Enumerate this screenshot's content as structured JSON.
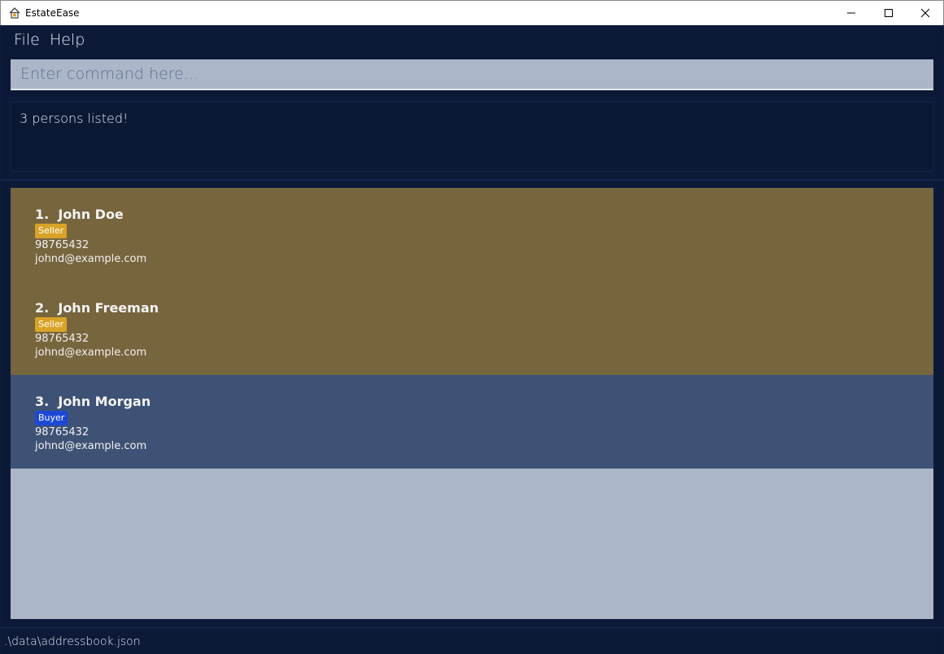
{
  "window": {
    "title": "EstateEase",
    "icon": "house-icon",
    "controls": {
      "minimize": "minimize-icon",
      "maximize": "maximize-icon",
      "close": "close-icon"
    }
  },
  "menu": {
    "file": "File",
    "help": "Help"
  },
  "command": {
    "placeholder": "Enter command here...",
    "value": ""
  },
  "result": {
    "message": "3 persons listed!"
  },
  "persons": [
    {
      "index": "1.",
      "name": "John Doe",
      "role": "Seller",
      "phone": "98765432",
      "email": "johnd@example.com"
    },
    {
      "index": "2.",
      "name": "John Freeman",
      "role": "Seller",
      "phone": "98765432",
      "email": "johnd@example.com"
    },
    {
      "index": "3.",
      "name": "John Morgan",
      "role": "Buyer",
      "phone": "98765432",
      "email": "johnd@example.com"
    }
  ],
  "colors": {
    "seller_card": "#77653e",
    "buyer_card": "#3e5275",
    "seller_tag": "#d9a327",
    "buyer_tag": "#1b48d6",
    "background": "#0f1e3c"
  },
  "status": {
    "path": ".\\data\\addressbook.json"
  }
}
